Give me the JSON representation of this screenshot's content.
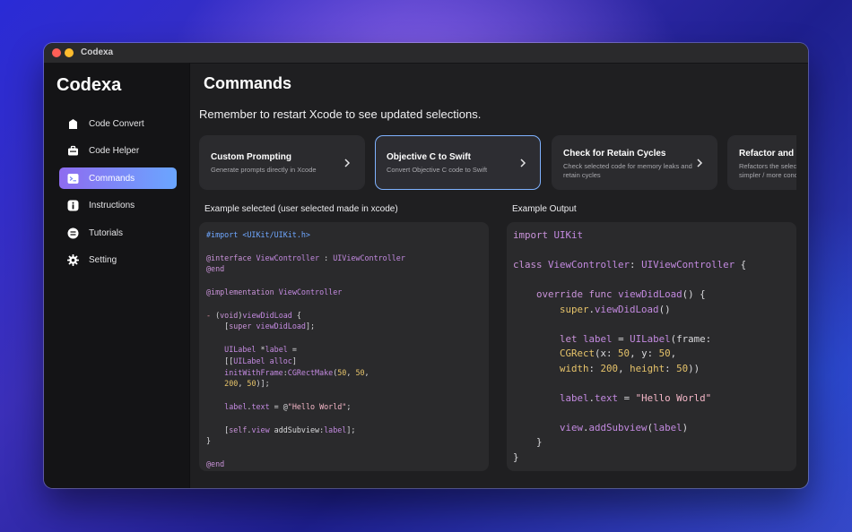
{
  "window": {
    "title": "Codexa"
  },
  "sidebar": {
    "app_name": "Codexa",
    "items": [
      {
        "label": "Code Convert",
        "icon": "document-icon"
      },
      {
        "label": "Code Helper",
        "icon": "briefcase-icon"
      },
      {
        "label": "Commands",
        "icon": "terminal-icon",
        "active": true
      },
      {
        "label": "Instructions",
        "icon": "info-icon"
      },
      {
        "label": "Tutorials",
        "icon": "play-icon"
      },
      {
        "label": "Setting",
        "icon": "gear-icon"
      }
    ]
  },
  "main": {
    "title": "Commands",
    "subtitle": "Remember to restart Xcode to see updated selections.",
    "cards": [
      {
        "title": "Custom Prompting",
        "desc": "Generate prompts directly in Xcode"
      },
      {
        "title": "Objective C to Swift",
        "desc": "Convert Objective C code to Swift",
        "selected": true
      },
      {
        "title": "Check for Retain Cycles",
        "desc": "Check selected code for memory leaks and retain cycles"
      },
      {
        "title": "Refactor and Simplify",
        "desc": "Refactors the selected code to make it simpler / more concise"
      }
    ],
    "input_label": "Example selected (user selected made in xcode)",
    "output_label": "Example Output"
  },
  "colors": {
    "accent_start": "#8e6cf0",
    "accent_end": "#6aa6ff",
    "selected_border": "#7fb2ff"
  }
}
